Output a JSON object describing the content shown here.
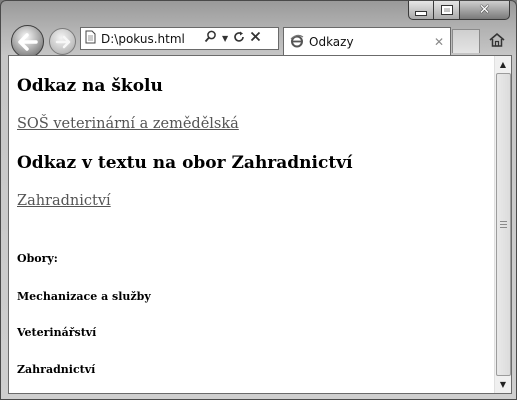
{
  "address_bar": {
    "url": "D:\\pokus.html"
  },
  "tab": {
    "title": "Odkazy"
  },
  "page": {
    "heading_school": "Odkaz na školu",
    "link_school": "SOŠ veterinární a zemědělská",
    "heading_field": "Odkaz v textu na obor Zahradnictví",
    "link_field": "Zahradnictví",
    "fields_label": "Obory:",
    "field_items": [
      "Mechanizace a služby",
      "Veterinářství",
      "Zahradnictví"
    ]
  }
}
